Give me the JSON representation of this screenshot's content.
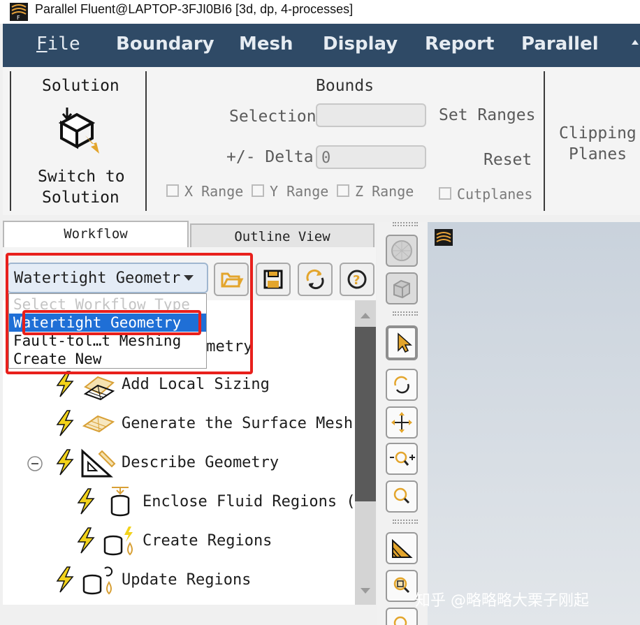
{
  "window": {
    "title": "Parallel Fluent@LAPTOP-3FJI0BI6  [3d, dp, 4-processes]"
  },
  "menu": {
    "file_first": "F",
    "file_rest": "ile",
    "items": [
      "Boundary",
      "Mesh",
      "Display",
      "Report",
      "Parallel"
    ]
  },
  "ribbon": {
    "solution": {
      "title": "Solution",
      "button_label_line1": "Switch to",
      "button_label_line2": "Solution"
    },
    "bounds": {
      "title": "Bounds",
      "selection_label": "Selection",
      "selection_value": "",
      "delta_label": "+/- Delta",
      "delta_value": "0",
      "set_ranges": "Set Ranges",
      "reset": "Reset",
      "x_range": "X Range",
      "y_range": "Y Range",
      "z_range": "Z Range",
      "cutplanes": "Cutplanes"
    },
    "clipping": {
      "line1": "Clipping",
      "line2": "Planes"
    }
  },
  "tabs": {
    "workflow": "Workflow",
    "outline": "Outline View"
  },
  "workflow": {
    "selected": "Watertight Geometr",
    "options": [
      {
        "label": "Select Workflow Type",
        "state": "disabled"
      },
      {
        "label": "Watertight Geometry",
        "state": "highlighted"
      },
      {
        "label": "Fault-tol…t Meshing",
        "state": "normal"
      },
      {
        "label": "Create New",
        "state": "normal"
      }
    ]
  },
  "tree": {
    "partial_item": "ometry",
    "items": [
      {
        "label": "Add Local Sizing"
      },
      {
        "label": "Generate the Surface Mesh"
      },
      {
        "label": "Describe Geometry"
      },
      {
        "label": "Enclose Fluid Regions ("
      },
      {
        "label": "Create Regions"
      },
      {
        "label": "Update Regions"
      }
    ]
  },
  "watermark": "知乎 @略略略大栗子刚起",
  "colors": {
    "menubar": "#2f4a66",
    "highlight": "#1f6fd6",
    "annotation": "#e8201c",
    "bolt": "#f2d21a"
  }
}
